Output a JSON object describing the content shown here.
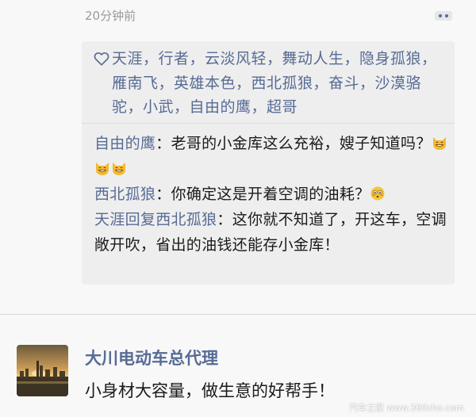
{
  "post_meta": {
    "timestamp": "20分钟前"
  },
  "likes": {
    "names": "天涯，行者，云淡风轻，舞动人生，隐身孤狼，雁南飞，英雄本色，西北孤狼，奋斗，沙漠骆驼，小武，自由的鹰，超哥"
  },
  "comments": [
    {
      "author": "自由的鹰",
      "separator": "：",
      "text": "老哥的小金库这么充裕，嫂子知道吗？",
      "emojis": [
        "grinning-cat-emoji",
        "grinning-cat-emoji",
        "grinning-cat-emoji"
      ]
    },
    {
      "author": "西北孤狼",
      "separator": "：",
      "text": "你确定这是开着空调的油耗？",
      "emojis": [
        "flushed-face-emoji"
      ]
    },
    {
      "author": "天涯回复西北孤狼",
      "separator": "：",
      "text": "这你就不知道了，开这车，空调敞开吹，省出的油钱还能存小金库！",
      "emojis": []
    }
  ],
  "next_post": {
    "author": "大川电动车总代理",
    "text": "小身材大容量，做生意的好帮手！"
  },
  "watermark": "汽车之家 www.360che.com",
  "colors": {
    "link_blue": "#576b95",
    "background": "#f8f8f8",
    "comment_box": "#eeeeee",
    "timestamp_gray": "#9a9a9a"
  }
}
